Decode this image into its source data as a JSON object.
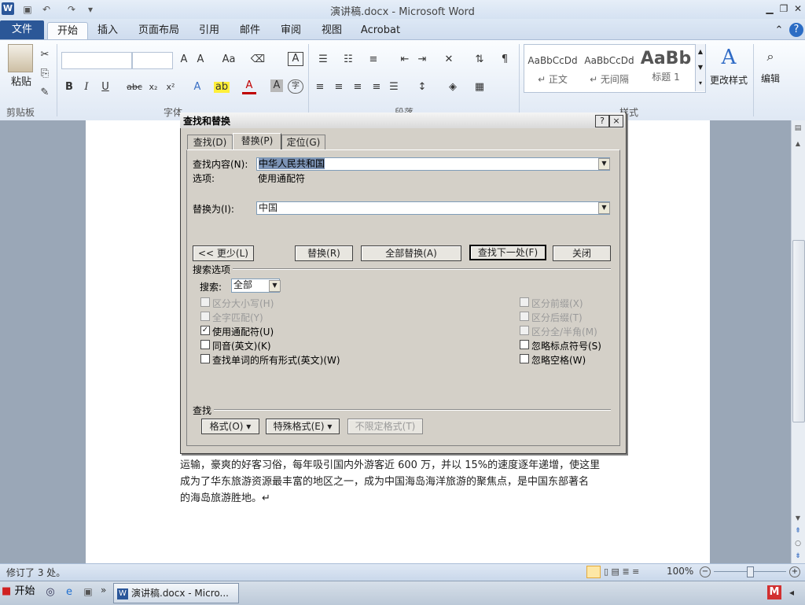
{
  "window": {
    "title": "演讲稿.docx - Microsoft Word"
  },
  "tabs": [
    "文件",
    "开始",
    "插入",
    "页面布局",
    "引用",
    "邮件",
    "审阅",
    "视图",
    "Acrobat"
  ],
  "ribbon": {
    "paste": "粘贴",
    "groups": [
      "剪贴板",
      "字体",
      "段落",
      "样式"
    ],
    "styles": [
      {
        "preview": "AaBbCcDd",
        "name": "↵ 正文"
      },
      {
        "preview": "AaBbCcDd",
        "name": "↵ 无间隔"
      },
      {
        "preview": "AaBb",
        "name": "标题 1"
      }
    ],
    "change_styles": "更改样式",
    "edit": "编辑"
  },
  "dialog": {
    "title": "查找和替换",
    "help": "?",
    "close": "×",
    "tabs": [
      "查找(D)",
      "替换(P)",
      "定位(G)"
    ],
    "find_label": "查找内容(N):",
    "find_value": "中华人民共和国",
    "options_label": "选项:",
    "options_value": "使用通配符",
    "replace_label": "替换为(I):",
    "replace_value": "中国",
    "buttons": {
      "less": "<< 更少(L)",
      "replace": "替换(R)",
      "replace_all": "全部替换(A)",
      "find_next": "查找下一处(F)",
      "close": "关闭"
    },
    "search_options_title": "搜索选项",
    "search_label": "搜索:",
    "search_value": "全部",
    "left_options": [
      {
        "label": "区分大小写(H)",
        "checked": false,
        "disabled": true
      },
      {
        "label": "全字匹配(Y)",
        "checked": false,
        "disabled": true
      },
      {
        "label": "使用通配符(U)",
        "checked": true,
        "disabled": false
      },
      {
        "label": "同音(英文)(K)",
        "checked": false,
        "disabled": false
      },
      {
        "label": "查找单词的所有形式(英文)(W)",
        "checked": false,
        "disabled": false
      }
    ],
    "right_options": [
      {
        "label": "区分前缀(X)",
        "checked": false,
        "disabled": true
      },
      {
        "label": "区分后缀(T)",
        "checked": false,
        "disabled": true
      },
      {
        "label": "区分全/半角(M)",
        "checked": false,
        "disabled": true
      },
      {
        "label": "忽略标点符号(S)",
        "checked": false,
        "disabled": false
      },
      {
        "label": "忽略空格(W)",
        "checked": false,
        "disabled": false
      }
    ],
    "find_section_title": "查找",
    "format_buttons": {
      "format": "格式(O) ▾",
      "special": "特殊格式(E) ▾",
      "no_format": "不限定格式(T)"
    }
  },
  "document": {
    "lines": [
      "运输，豪爽的好客习俗，每年吸引国内外游客近 600 万，并以 15%的速度逐年递增，使这里",
      "成为了华东旅游资源最丰富的地区之一，成为中国海岛海洋旅游的聚焦点，是中国东部著名",
      "的海岛旅游胜地。↵"
    ]
  },
  "statusbar": {
    "left": "修订了 3 处。",
    "zoom": "100%"
  },
  "taskbar": {
    "start": "开始",
    "item": "演讲稿.docx - Micro..."
  }
}
